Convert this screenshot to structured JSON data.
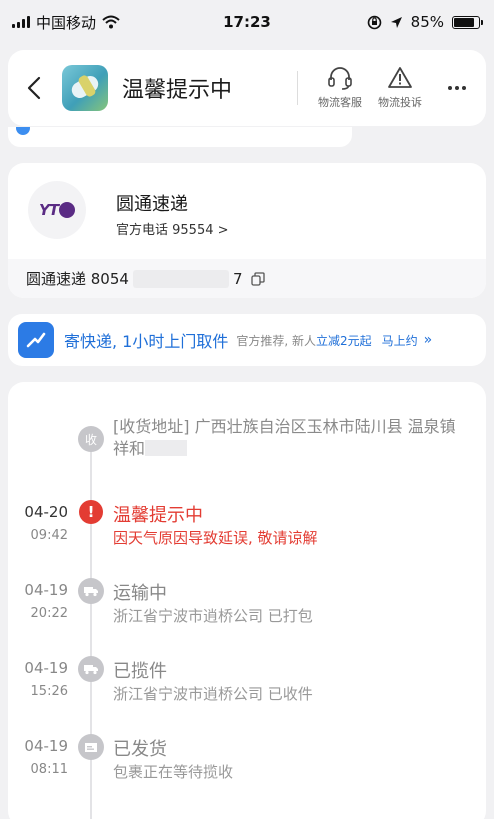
{
  "status_bar": {
    "carrier": "中国移动",
    "time": "17:23",
    "battery": "85%",
    "battery_level": 0.85
  },
  "header": {
    "title": "温馨提示中",
    "service_label": "物流客服",
    "complaint_label": "物流投诉"
  },
  "company": {
    "name": "圆通速递",
    "phone": "官方电话 95554 >",
    "logo_text": "YT",
    "tracking_prefix": "圆通速递 8054",
    "tracking_suffix": "7"
  },
  "promo": {
    "title": "寄快递, 1小时上门取件",
    "sub_prefix": "官方推荐, 新人",
    "sub_highlight": "立减2元起",
    "cta": "马上约",
    "chevron": "»"
  },
  "timeline": {
    "address_node": "收",
    "address_text": "[收货地址] 广西壮族自治区玉林市陆川县 温泉镇 祥和",
    "events": [
      {
        "date": "04-20",
        "time": "09:42",
        "title": "温馨提示中",
        "desc": "因天气原因导致延误, 敬请谅解"
      },
      {
        "date": "04-19",
        "time": "20:22",
        "title": "运输中",
        "desc": "浙江省宁波市逍桥公司 已打包"
      },
      {
        "date": "04-19",
        "time": "15:26",
        "title": "已揽件",
        "desc": "浙江省宁波市逍桥公司 已收件"
      },
      {
        "date": "04-19",
        "time": "08:11",
        "title": "已发货",
        "desc": "包裹正在等待揽收"
      }
    ]
  },
  "colors": {
    "accent_red": "#e33c33",
    "accent_blue": "#1f6fd8",
    "brand_purple": "#5a2b84"
  }
}
